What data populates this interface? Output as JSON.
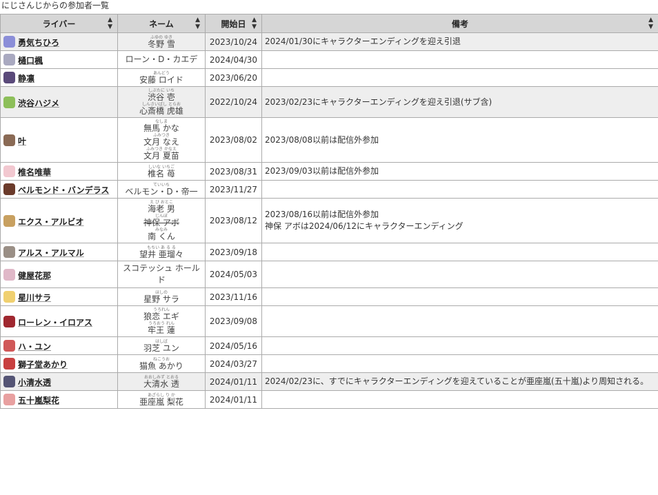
{
  "caption": "にじさんじからの参加者一覧",
  "headers": {
    "liver": "ライバー",
    "name": "ネーム",
    "start": "開始日",
    "note": "備考",
    "sort_icon": "sort-arrows-icon"
  },
  "rows": [
    {
      "liver": "勇気ちひろ",
      "avatar_color": "#8b8ed8",
      "shaded": true,
      "names": [
        {
          "ruby": "ふゆの ゆき",
          "text": "冬野 雪"
        }
      ],
      "date": "2023/10/24",
      "notes": [
        "2024/01/30にキャラクターエンディングを迎え引退"
      ]
    },
    {
      "liver": "樋口楓",
      "avatar_color": "#a9a9c0",
      "shaded": false,
      "names": [
        {
          "ruby": "",
          "text": "ローン・D・カエデ"
        }
      ],
      "date": "2024/04/30",
      "notes": []
    },
    {
      "liver": "静凛",
      "avatar_color": "#5a4a7a",
      "shaded": false,
      "names": [
        {
          "ruby": "あんどう",
          "text": "安藤 ロイド"
        }
      ],
      "date": "2023/06/20",
      "notes": []
    },
    {
      "liver": "渋谷ハジメ",
      "avatar_color": "#8dbf5a",
      "shaded": true,
      "names": [
        {
          "ruby": "しぶたに いち",
          "text": "渋谷 壱"
        },
        {
          "ruby": "しんさいばし とらお",
          "text": "心斎橋 虎雄"
        }
      ],
      "date": "2022/10/24",
      "notes": [
        "2023/02/23にキャラクターエンディングを迎え引退(サブ含)"
      ]
    },
    {
      "liver": "叶",
      "avatar_color": "#8a6a55",
      "shaded": false,
      "names": [
        {
          "ruby": "なしま",
          "text": "無馬 かな"
        },
        {
          "ruby": "ふみつき",
          "text": "文月 なえ"
        },
        {
          "ruby": "ふみつき かなえ",
          "text": "文月 夏苗"
        }
      ],
      "date": "2023/08/02",
      "notes": [
        "2023/08/08以前は配信外参加"
      ]
    },
    {
      "liver": "椎名唯華",
      "avatar_color": "#f2c8d0",
      "shaded": false,
      "names": [
        {
          "ruby": "しいな いちご",
          "text": "椎名 苺"
        }
      ],
      "date": "2023/08/31",
      "notes": [
        "2023/09/03以前は配信外参加"
      ]
    },
    {
      "liver": "ベルモンド・バンデラス",
      "avatar_color": "#6b3b2b",
      "shaded": false,
      "names": [
        {
          "ruby": "ていいち",
          "text": "ベルモン・D・帝一"
        }
      ],
      "date": "2023/11/27",
      "notes": []
    },
    {
      "liver": "エクス・アルビオ",
      "avatar_color": "#c8a060",
      "shaded": false,
      "names": [
        {
          "ruby": "え び おとこ",
          "text": "海老 男"
        },
        {
          "ruby": "じんぼ",
          "text": "神保 アボ",
          "strike": true
        },
        {
          "ruby": "みなみ",
          "text": "南 くん"
        }
      ],
      "date": "2023/08/12",
      "notes": [
        "2023/08/16以前は配信外参加",
        "神保 アボは2024/06/12にキャラクターエンディング"
      ]
    },
    {
      "liver": "アルス・アルマル",
      "avatar_color": "#9a8f86",
      "shaded": false,
      "names": [
        {
          "ruby": "もちい あ る る",
          "text": "望井 亜瑠々"
        }
      ],
      "date": "2023/09/18",
      "notes": []
    },
    {
      "liver": "健屋花那",
      "avatar_color": "#e0b8c8",
      "shaded": false,
      "names": [
        {
          "ruby": "",
          "text": "スコテッシュ ホールド"
        }
      ],
      "date": "2024/05/03",
      "notes": []
    },
    {
      "liver": "星川サラ",
      "avatar_color": "#f0d070",
      "shaded": false,
      "names": [
        {
          "ruby": "ほしの",
          "text": "星野 サラ"
        }
      ],
      "date": "2023/11/16",
      "notes": []
    },
    {
      "liver": "ローレン・イロアス",
      "avatar_color": "#a02830",
      "shaded": false,
      "names": [
        {
          "ruby": "うろれん",
          "text": "狼恋 エギ"
        },
        {
          "ruby": "うろおう れん",
          "text": "牢王 蓮"
        }
      ],
      "date": "2023/09/08",
      "notes": []
    },
    {
      "liver": "ハ・ユン",
      "avatar_color": "#d05858",
      "shaded": false,
      "names": [
        {
          "ruby": "はしば",
          "text": "羽芝 ユン"
        }
      ],
      "date": "2024/05/16",
      "notes": []
    },
    {
      "liver": "獅子堂あかり",
      "avatar_color": "#c84040",
      "shaded": false,
      "names": [
        {
          "ruby": "ねこうお",
          "text": "猫魚 あかり"
        }
      ],
      "date": "2024/03/27",
      "notes": []
    },
    {
      "liver": "小清水透",
      "avatar_color": "#555575",
      "shaded": true,
      "names": [
        {
          "ruby": "おおしみず とおる",
          "text": "大清水 透"
        }
      ],
      "date": "2024/01/11",
      "notes": [
        "2024/02/23に、すでにキャラクターエンディングを迎えていることが亜座嵐(五十嵐)より周知される。"
      ]
    },
    {
      "liver": "五十嵐梨花",
      "avatar_color": "#e8a0a0",
      "shaded": false,
      "names": [
        {
          "ruby": "あざらし り か",
          "text": "亜座嵐 梨花"
        }
      ],
      "date": "2024/01/11",
      "notes": []
    }
  ]
}
